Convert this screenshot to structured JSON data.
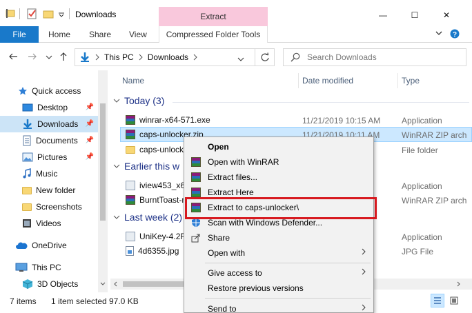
{
  "window": {
    "title": "Downloads",
    "context_tab_group": "Extract",
    "controls": {
      "minimize": "—",
      "maximize": "☐",
      "close": "✕"
    }
  },
  "ribbon": {
    "tabs": [
      "File",
      "Home",
      "Share",
      "View"
    ],
    "context_tab": "Compressed Folder Tools"
  },
  "address": {
    "path": [
      "This PC",
      "Downloads"
    ],
    "search_placeholder": "Search Downloads"
  },
  "nav_pane": {
    "items": [
      {
        "label": "Quick access",
        "icon": "star-icon",
        "pinned": false
      },
      {
        "label": "Desktop",
        "icon": "desktop-icon",
        "pinned": true
      },
      {
        "label": "Downloads",
        "icon": "download-arrow-icon",
        "pinned": true,
        "selected": true
      },
      {
        "label": "Documents",
        "icon": "document-icon",
        "pinned": true
      },
      {
        "label": "Pictures",
        "icon": "pictures-icon",
        "pinned": true
      },
      {
        "label": "Music",
        "icon": "music-icon",
        "pinned": false
      },
      {
        "label": "New folder",
        "icon": "folder-icon",
        "pinned": false
      },
      {
        "label": "Screenshots",
        "icon": "folder-icon",
        "pinned": false
      },
      {
        "label": "Videos",
        "icon": "video-icon",
        "pinned": false
      },
      {
        "label": "OneDrive",
        "icon": "cloud-icon",
        "pinned": false
      },
      {
        "label": "This PC",
        "icon": "computer-icon",
        "pinned": false
      },
      {
        "label": "3D Objects",
        "icon": "cube-icon",
        "pinned": false
      }
    ]
  },
  "columns": {
    "name": "Name",
    "date": "Date modified",
    "type": "Type"
  },
  "groups": [
    {
      "label": "Today (3)",
      "files": [
        {
          "name": "winrar-x64-571.exe",
          "date": "11/21/2019 10:15 AM",
          "type": "Application",
          "icon": "winrar"
        },
        {
          "name": "caps-unlocker.zip",
          "date": "11/21/2019 10:11 AM",
          "type": "WinRAR ZIP arch",
          "icon": "winrar",
          "selected": true
        },
        {
          "name": "caps-unlocker",
          "date": "",
          "type": "File folder",
          "icon": "folder"
        }
      ]
    },
    {
      "label": "Earlier this w",
      "files": [
        {
          "name": "iview453_x64",
          "date": "",
          "type": "Application",
          "icon": "exe"
        },
        {
          "name": "BurntToast-n",
          "date": "",
          "type": "WinRAR ZIP arch",
          "icon": "winrar"
        }
      ]
    },
    {
      "label": "Last week (2)",
      "files": [
        {
          "name": "UniKey-4.2RC",
          "date": "",
          "type": "Application",
          "icon": "exe"
        },
        {
          "name": "4d6355.jpg",
          "date": "",
          "type": "JPG File",
          "icon": "jpg"
        }
      ]
    }
  ],
  "status": {
    "count": "7 items",
    "selection": "1 item selected",
    "size": "97.0 KB"
  },
  "context_menu": {
    "items": [
      {
        "label": "Open",
        "bold": true,
        "icon": ""
      },
      {
        "label": "Open with WinRAR",
        "icon": "winrar"
      },
      {
        "label": "Extract files...",
        "icon": "winrar"
      },
      {
        "label": "Extract Here",
        "icon": "winrar"
      },
      {
        "label": "Extract to caps-unlocker\\",
        "icon": "winrar",
        "highlighted": true
      },
      {
        "label": "Scan with Windows Defender...",
        "icon": "defender"
      },
      {
        "label": "Share",
        "icon": "share"
      },
      {
        "label": "Open with",
        "icon": "",
        "submenu": true
      },
      {
        "label": "Give access to",
        "icon": "",
        "submenu": true
      },
      {
        "label": "Restore previous versions",
        "icon": ""
      },
      {
        "label": "Send to",
        "icon": "",
        "submenu": true
      }
    ]
  },
  "colors": {
    "accent": "#1979ca",
    "context_tab": "#f9c8dc",
    "selection": "#cce8ff",
    "highlight_box": "#d7191f",
    "group_header": "#1e3287"
  }
}
